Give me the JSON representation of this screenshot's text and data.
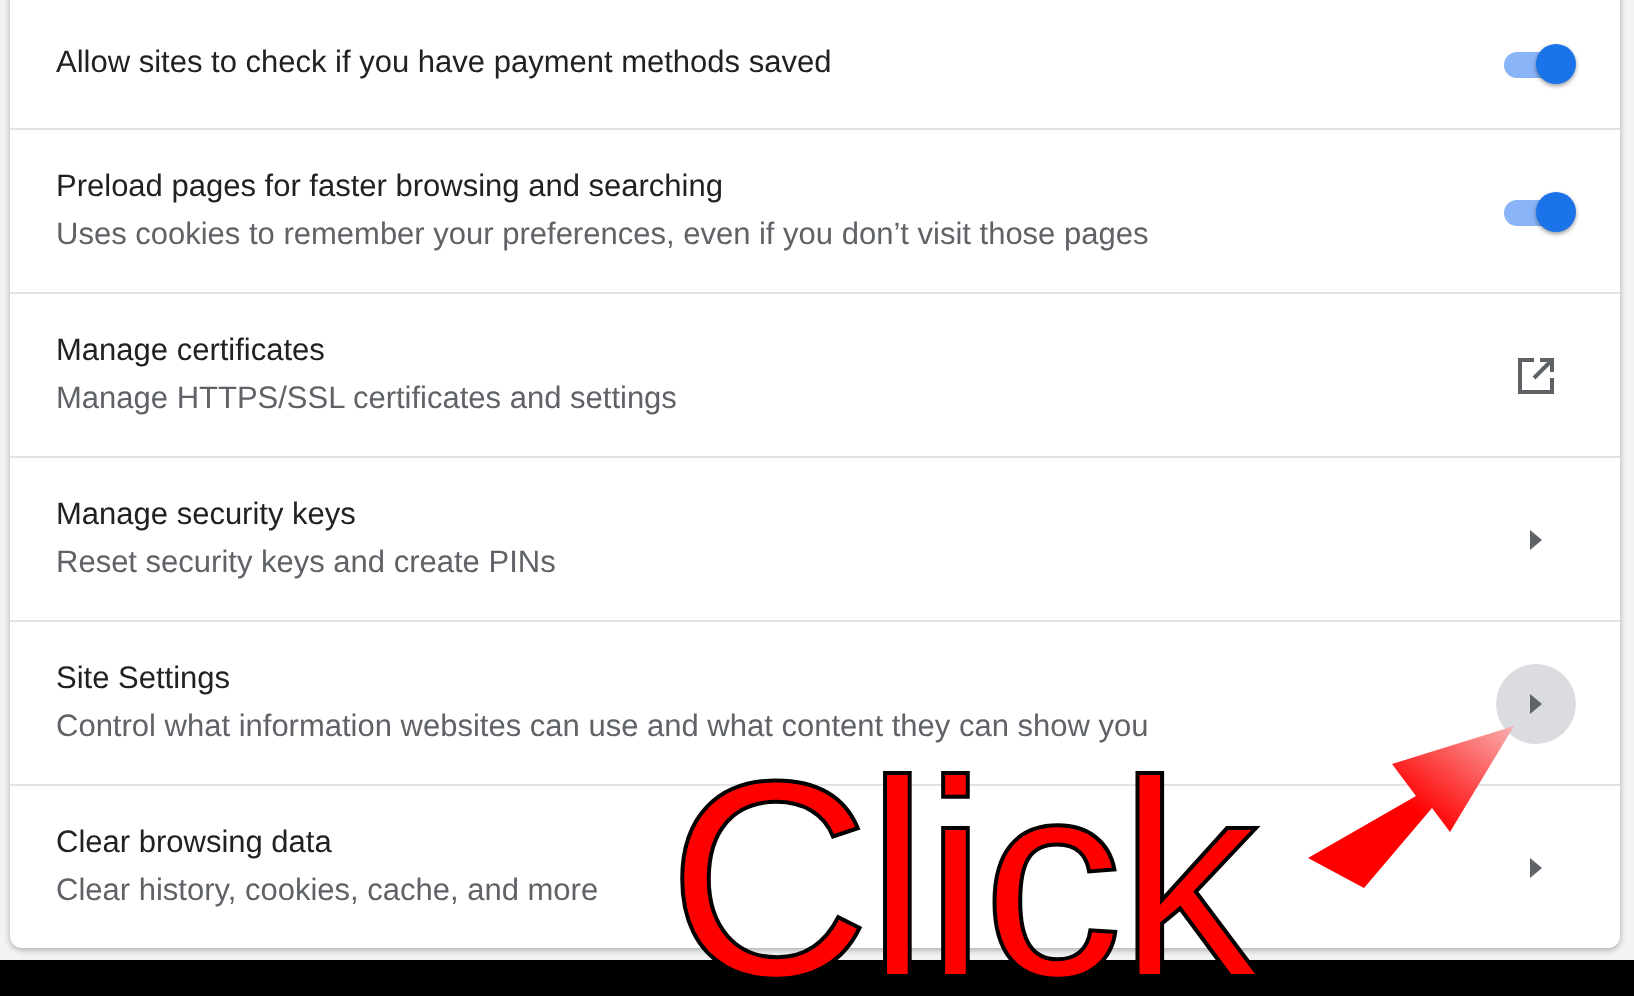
{
  "rows": [
    {
      "kind": "toggle",
      "title": "Allow sites to check if you have payment methods saved",
      "on": true
    },
    {
      "kind": "toggle",
      "title": "Preload pages for faster browsing and searching",
      "subtitle": "Uses cookies to remember your preferences, even if you don’t visit those pages",
      "on": true
    },
    {
      "kind": "external",
      "title": "Manage certificates",
      "subtitle": "Manage HTTPS/SSL certificates and settings"
    },
    {
      "kind": "arrow",
      "title": "Manage security keys",
      "subtitle": "Reset security keys and create PINs",
      "hovered": false
    },
    {
      "kind": "arrow",
      "title": "Site Settings",
      "subtitle": "Control what information websites can use and what content they can show you",
      "hovered": true
    },
    {
      "kind": "arrow",
      "title": "Clear browsing data",
      "subtitle": "Clear history, cookies, cache, and more",
      "hovered": false
    }
  ],
  "annotation": {
    "text": "Click"
  }
}
